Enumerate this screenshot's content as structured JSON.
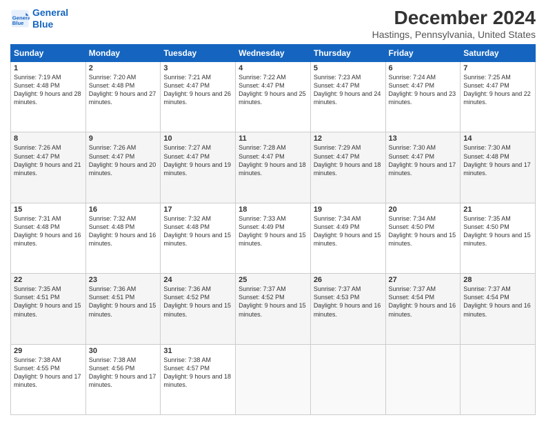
{
  "logo": {
    "line1": "General",
    "line2": "Blue"
  },
  "title": "December 2024",
  "subtitle": "Hastings, Pennsylvania, United States",
  "weekdays": [
    "Sunday",
    "Monday",
    "Tuesday",
    "Wednesday",
    "Thursday",
    "Friday",
    "Saturday"
  ],
  "weeks": [
    [
      {
        "day": "1",
        "sunrise": "7:19 AM",
        "sunset": "4:48 PM",
        "daylight": "9 hours and 28 minutes."
      },
      {
        "day": "2",
        "sunrise": "7:20 AM",
        "sunset": "4:48 PM",
        "daylight": "9 hours and 27 minutes."
      },
      {
        "day": "3",
        "sunrise": "7:21 AM",
        "sunset": "4:47 PM",
        "daylight": "9 hours and 26 minutes."
      },
      {
        "day": "4",
        "sunrise": "7:22 AM",
        "sunset": "4:47 PM",
        "daylight": "9 hours and 25 minutes."
      },
      {
        "day": "5",
        "sunrise": "7:23 AM",
        "sunset": "4:47 PM",
        "daylight": "9 hours and 24 minutes."
      },
      {
        "day": "6",
        "sunrise": "7:24 AM",
        "sunset": "4:47 PM",
        "daylight": "9 hours and 23 minutes."
      },
      {
        "day": "7",
        "sunrise": "7:25 AM",
        "sunset": "4:47 PM",
        "daylight": "9 hours and 22 minutes."
      }
    ],
    [
      {
        "day": "8",
        "sunrise": "7:26 AM",
        "sunset": "4:47 PM",
        "daylight": "9 hours and 21 minutes."
      },
      {
        "day": "9",
        "sunrise": "7:26 AM",
        "sunset": "4:47 PM",
        "daylight": "9 hours and 20 minutes."
      },
      {
        "day": "10",
        "sunrise": "7:27 AM",
        "sunset": "4:47 PM",
        "daylight": "9 hours and 19 minutes."
      },
      {
        "day": "11",
        "sunrise": "7:28 AM",
        "sunset": "4:47 PM",
        "daylight": "9 hours and 18 minutes."
      },
      {
        "day": "12",
        "sunrise": "7:29 AM",
        "sunset": "4:47 PM",
        "daylight": "9 hours and 18 minutes."
      },
      {
        "day": "13",
        "sunrise": "7:30 AM",
        "sunset": "4:47 PM",
        "daylight": "9 hours and 17 minutes."
      },
      {
        "day": "14",
        "sunrise": "7:30 AM",
        "sunset": "4:48 PM",
        "daylight": "9 hours and 17 minutes."
      }
    ],
    [
      {
        "day": "15",
        "sunrise": "7:31 AM",
        "sunset": "4:48 PM",
        "daylight": "9 hours and 16 minutes."
      },
      {
        "day": "16",
        "sunrise": "7:32 AM",
        "sunset": "4:48 PM",
        "daylight": "9 hours and 16 minutes."
      },
      {
        "day": "17",
        "sunrise": "7:32 AM",
        "sunset": "4:48 PM",
        "daylight": "9 hours and 15 minutes."
      },
      {
        "day": "18",
        "sunrise": "7:33 AM",
        "sunset": "4:49 PM",
        "daylight": "9 hours and 15 minutes."
      },
      {
        "day": "19",
        "sunrise": "7:34 AM",
        "sunset": "4:49 PM",
        "daylight": "9 hours and 15 minutes."
      },
      {
        "day": "20",
        "sunrise": "7:34 AM",
        "sunset": "4:50 PM",
        "daylight": "9 hours and 15 minutes."
      },
      {
        "day": "21",
        "sunrise": "7:35 AM",
        "sunset": "4:50 PM",
        "daylight": "9 hours and 15 minutes."
      }
    ],
    [
      {
        "day": "22",
        "sunrise": "7:35 AM",
        "sunset": "4:51 PM",
        "daylight": "9 hours and 15 minutes."
      },
      {
        "day": "23",
        "sunrise": "7:36 AM",
        "sunset": "4:51 PM",
        "daylight": "9 hours and 15 minutes."
      },
      {
        "day": "24",
        "sunrise": "7:36 AM",
        "sunset": "4:52 PM",
        "daylight": "9 hours and 15 minutes."
      },
      {
        "day": "25",
        "sunrise": "7:37 AM",
        "sunset": "4:52 PM",
        "daylight": "9 hours and 15 minutes."
      },
      {
        "day": "26",
        "sunrise": "7:37 AM",
        "sunset": "4:53 PM",
        "daylight": "9 hours and 16 minutes."
      },
      {
        "day": "27",
        "sunrise": "7:37 AM",
        "sunset": "4:54 PM",
        "daylight": "9 hours and 16 minutes."
      },
      {
        "day": "28",
        "sunrise": "7:37 AM",
        "sunset": "4:54 PM",
        "daylight": "9 hours and 16 minutes."
      }
    ],
    [
      {
        "day": "29",
        "sunrise": "7:38 AM",
        "sunset": "4:55 PM",
        "daylight": "9 hours and 17 minutes."
      },
      {
        "day": "30",
        "sunrise": "7:38 AM",
        "sunset": "4:56 PM",
        "daylight": "9 hours and 17 minutes."
      },
      {
        "day": "31",
        "sunrise": "7:38 AM",
        "sunset": "4:57 PM",
        "daylight": "9 hours and 18 minutes."
      },
      null,
      null,
      null,
      null
    ]
  ]
}
